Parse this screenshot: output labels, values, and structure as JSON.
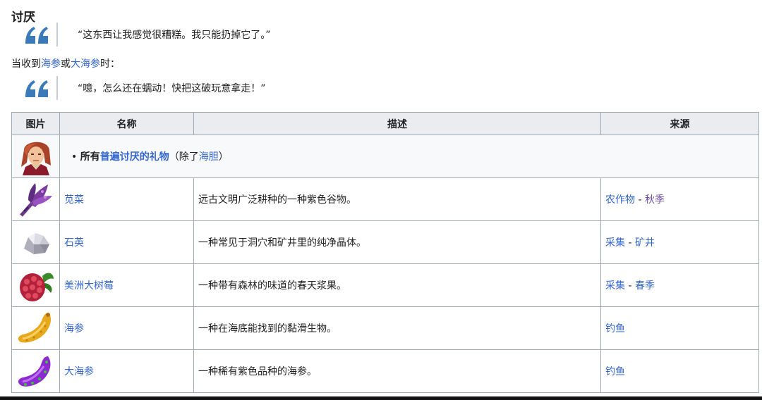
{
  "section": {
    "title": "讨厌"
  },
  "quotes": {
    "q1": "“这东西让我感觉很糟糕。我只能扔掉它了。”",
    "q2": "“噫，怎么还在蠕动！快把这破玩意拿走！”"
  },
  "condition": {
    "prefix": "当收到",
    "link1": "海参",
    "or": "或",
    "link2": "大海参",
    "suffix": "时："
  },
  "table": {
    "headers": {
      "image": "图片",
      "name": "名称",
      "description": "描述",
      "source": "来源"
    },
    "universal": {
      "bullet": "•",
      "prefix": "所有",
      "link": "普遍讨厌的礼物",
      "paren_open": "（除了",
      "except": "海胆",
      "paren_close": "）"
    },
    "rows": [
      {
        "name": "苋菜",
        "description": "远古文明广泛耕种的一种紫色谷物。",
        "source1": "农作物",
        "sep": " - ",
        "source2": "秋季"
      },
      {
        "name": "石英",
        "description": "一种常见于洞穴和矿井里的纯净晶体。",
        "source1": "采集",
        "sep": " - ",
        "source2": "矿井"
      },
      {
        "name": "美洲大树莓",
        "description": "一种带有森林的味道的春天浆果。",
        "source1": "采集",
        "sep": " - ",
        "source2": "春季"
      },
      {
        "name": "海参",
        "description": "一种在海底能找到的黏滑生物。",
        "source1": "钓鱼"
      },
      {
        "name": "大海参",
        "description": "一种稀有紫色品种的海参。",
        "source1": "钓鱼"
      }
    ]
  },
  "icons": [
    "quote-icon",
    "portrait-icon",
    "amaranth-icon",
    "quartz-icon",
    "salmonberry-icon",
    "sea-cucumber-icon",
    "super-cucumber-icon"
  ]
}
